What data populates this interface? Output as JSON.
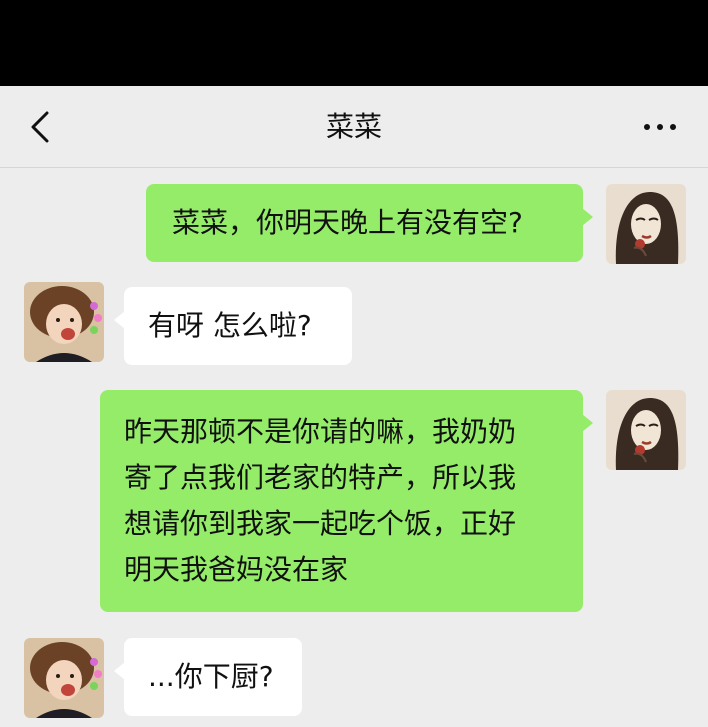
{
  "header": {
    "title": "菜菜",
    "back_icon": "chevron-left-icon",
    "more_icon": "more-dots-icon"
  },
  "colors": {
    "nav_background": "#ededed",
    "chat_background": "#ededed",
    "sent_bubble": "#95ec69",
    "received_bubble": "#ffffff"
  },
  "messages": [
    {
      "sender": "me",
      "lines": [
        "菜菜，你明天晚上有没有空?"
      ]
    },
    {
      "sender": "contact",
      "lines": [
        "有呀 怎么啦?"
      ]
    },
    {
      "sender": "me",
      "lines": [
        "昨天那顿不是你请的嘛，我奶奶",
        "寄了点我们老家的特产，所以我",
        "想请你到我家一起吃个饭，正好",
        "明天我爸妈没在家"
      ]
    },
    {
      "sender": "contact",
      "lines": [
        "...你下厨?"
      ]
    }
  ]
}
